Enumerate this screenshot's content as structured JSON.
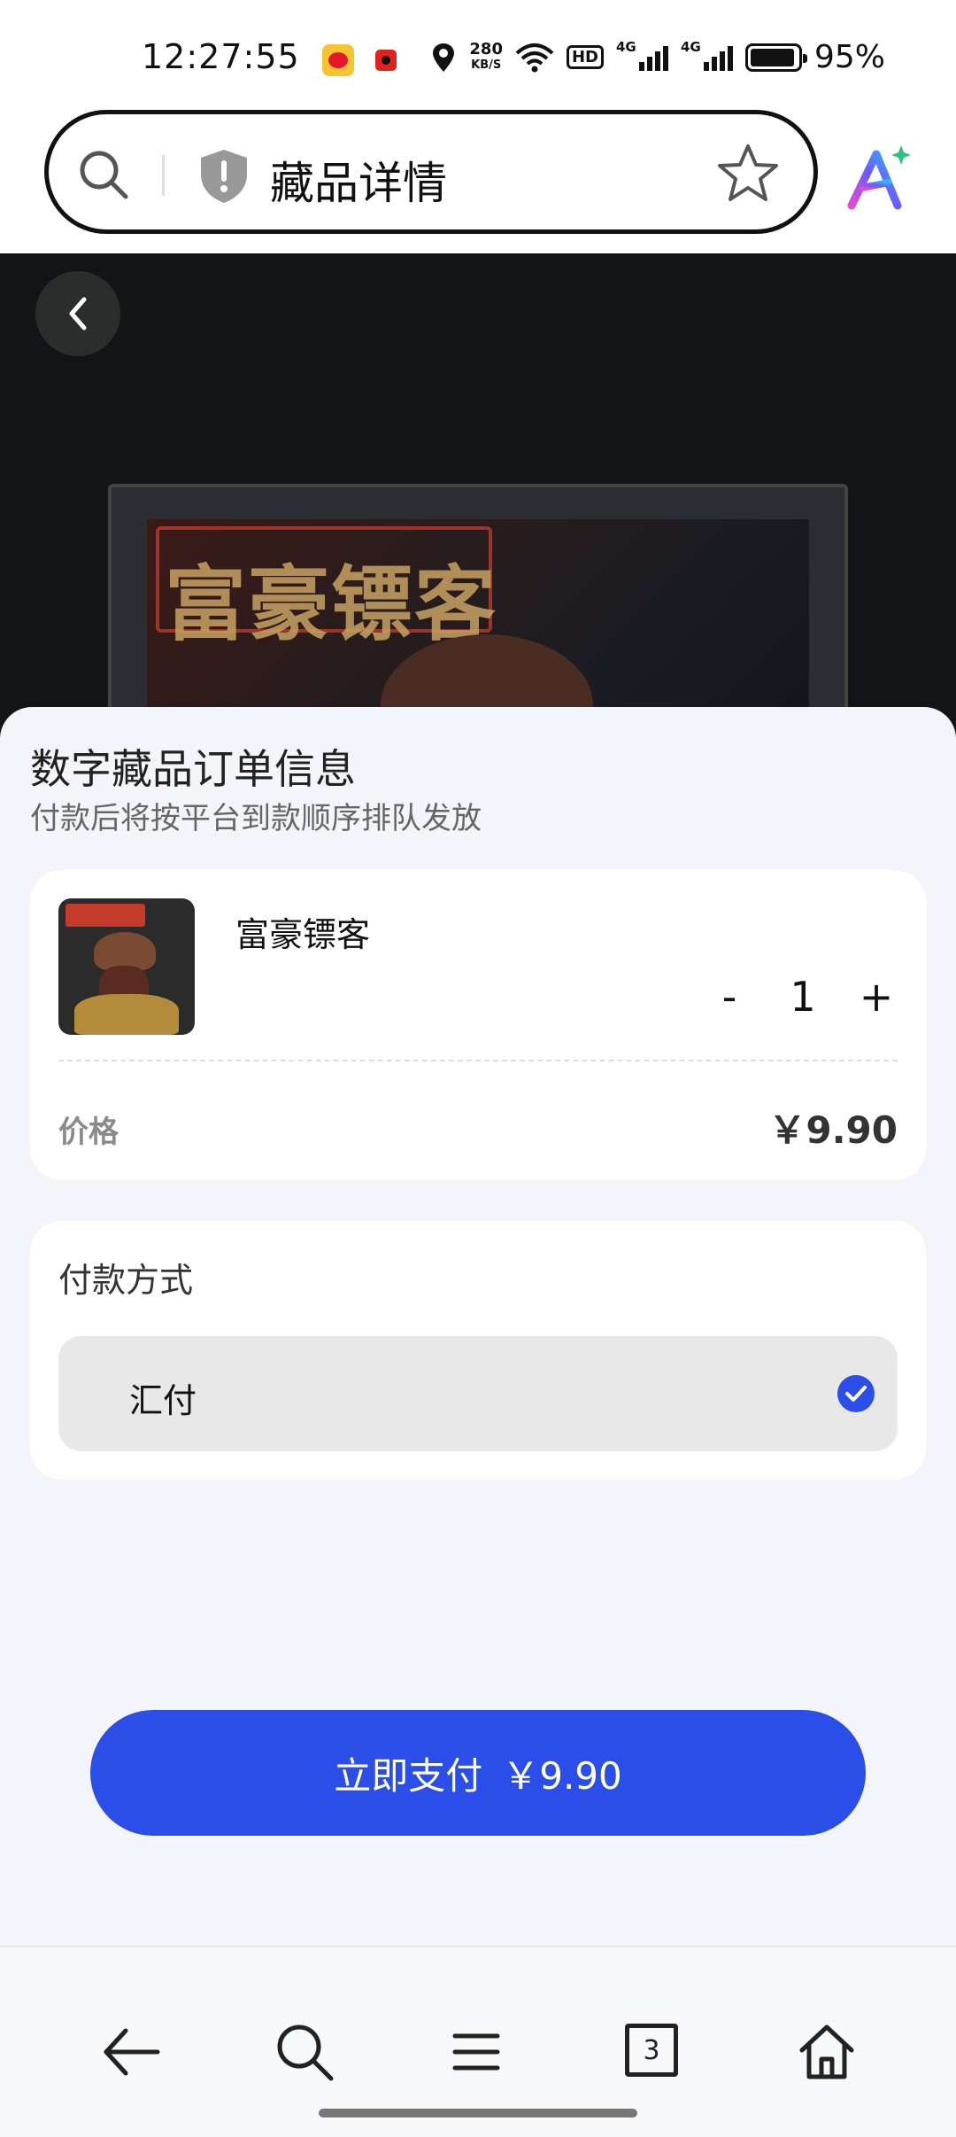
{
  "status_bar": {
    "time": "12:27:55",
    "net_speed_value": "280",
    "net_speed_unit": "KB/S",
    "hd_label": "HD",
    "sim1_label": "4G",
    "sim2_label": "4G",
    "battery_percent": "95%",
    "battery_level": 0.95
  },
  "address_bar": {
    "title": "藏品详情"
  },
  "hero": {
    "sign_text": "富豪镖客"
  },
  "order": {
    "heading": "数字藏品订单信息",
    "subheading": "付款后将按平台到款顺序排队发放",
    "item": {
      "name": "富豪镖客",
      "quantity": "1",
      "minus_label": "-",
      "plus_label": "+"
    },
    "price_label": "价格",
    "price_value": "￥9.90"
  },
  "payment": {
    "title": "付款方式",
    "option_label": "汇付",
    "option_selected": true
  },
  "pay_button": {
    "label": "立即支付",
    "amount": "￥9.90"
  },
  "bottom_nav": {
    "tab_count": "3",
    "items": [
      "back-icon",
      "search-icon",
      "menu-icon",
      "tabs-icon",
      "home-icon"
    ]
  },
  "colors": {
    "accent": "#2b4de8",
    "background": "#f3f5fa"
  }
}
